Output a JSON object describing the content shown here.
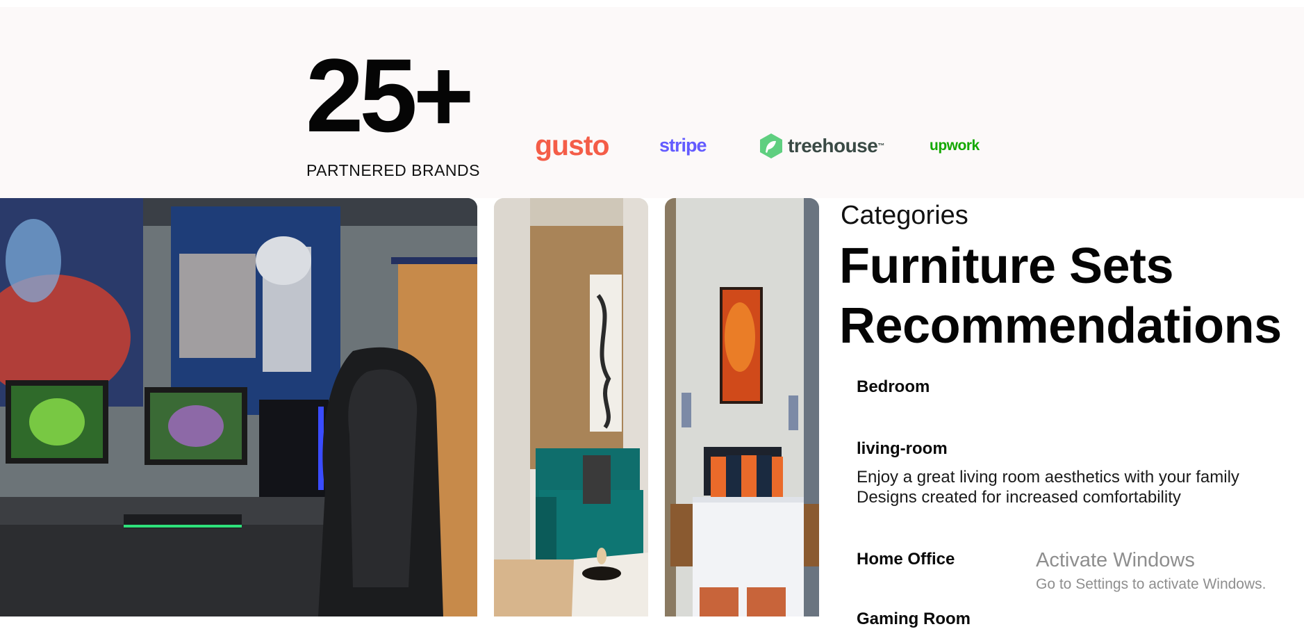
{
  "stats": {
    "number": "25+",
    "label": "PARTNERED BRANDS"
  },
  "brands": [
    {
      "name": "gusto",
      "color": "#f45d48"
    },
    {
      "name": "stripe",
      "color": "#635bff"
    },
    {
      "name": "treehouse",
      "color": "#3a4a45"
    },
    {
      "name": "upwork",
      "color": "#14a800"
    }
  ],
  "categories": {
    "kicker": "Categories",
    "title": "Furniture Sets Recommendations",
    "items": [
      {
        "name": "Bedroom"
      },
      {
        "name": "living-room",
        "description_lines": [
          "Enjoy a great living room aesthetics with your family",
          "Designs created for increased comfortability"
        ]
      },
      {
        "name": "Home Office"
      },
      {
        "name": "Gaming Room"
      }
    ]
  },
  "photos": [
    {
      "name": "gaming-setup-photo"
    },
    {
      "name": "living-room-photo"
    },
    {
      "name": "bedroom-photo"
    }
  ],
  "system_overlay": {
    "title": "Activate Windows",
    "subtitle": "Go to Settings to activate Windows."
  }
}
